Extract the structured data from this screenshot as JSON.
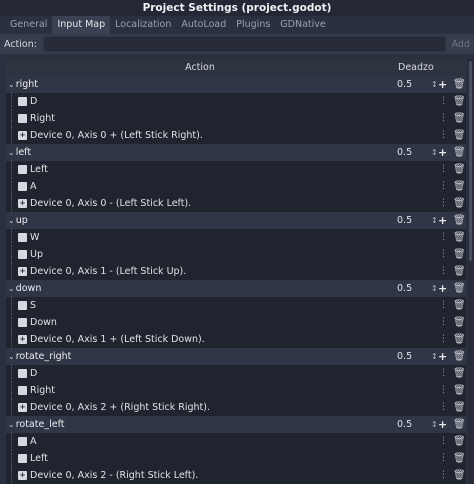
{
  "window": {
    "title": "Project Settings (project.godot)"
  },
  "tabs": [
    {
      "label": "General",
      "active": false
    },
    {
      "label": "Input Map",
      "active": true
    },
    {
      "label": "Localization",
      "active": false
    },
    {
      "label": "AutoLoad",
      "active": false
    },
    {
      "label": "Plugins",
      "active": false
    },
    {
      "label": "GDNative",
      "active": false
    }
  ],
  "action_bar": {
    "label": "Action:",
    "value": "",
    "add_label": "Add"
  },
  "table": {
    "headers": {
      "action": "Action",
      "deadzone": "Deadzo"
    },
    "actions": [
      {
        "name": "right",
        "deadzone": "0.5",
        "events": [
          {
            "icon": "key-icon",
            "text": "D"
          },
          {
            "icon": "key-icon",
            "text": "Right"
          },
          {
            "icon": "joypad-icon",
            "text": "Device 0, Axis 0 + (Left Stick Right)."
          }
        ]
      },
      {
        "name": "left",
        "deadzone": "0.5",
        "events": [
          {
            "icon": "key-icon",
            "text": "Left"
          },
          {
            "icon": "key-icon",
            "text": "A"
          },
          {
            "icon": "joypad-icon",
            "text": "Device 0, Axis 0 - (Left Stick Left)."
          }
        ]
      },
      {
        "name": "up",
        "deadzone": "0.5",
        "events": [
          {
            "icon": "key-icon",
            "text": "W"
          },
          {
            "icon": "key-icon",
            "text": "Up"
          },
          {
            "icon": "joypad-icon",
            "text": "Device 0, Axis 1 - (Left Stick Up)."
          }
        ]
      },
      {
        "name": "down",
        "deadzone": "0.5",
        "events": [
          {
            "icon": "key-icon",
            "text": "S"
          },
          {
            "icon": "key-icon",
            "text": "Down"
          },
          {
            "icon": "joypad-icon",
            "text": "Device 0, Axis 1 + (Left Stick Down)."
          }
        ]
      },
      {
        "name": "rotate_right",
        "deadzone": "0.5",
        "events": [
          {
            "icon": "key-icon",
            "text": "D"
          },
          {
            "icon": "key-icon",
            "text": "Right"
          },
          {
            "icon": "joypad-icon",
            "text": "Device 0, Axis 2 + (Right Stick Right)."
          }
        ]
      },
      {
        "name": "rotate_left",
        "deadzone": "0.5",
        "events": [
          {
            "icon": "key-icon",
            "text": "A"
          },
          {
            "icon": "key-icon",
            "text": "Left"
          },
          {
            "icon": "joypad-icon",
            "text": "Device 0, Axis 2 - (Right Stick Left)."
          }
        ]
      }
    ]
  }
}
